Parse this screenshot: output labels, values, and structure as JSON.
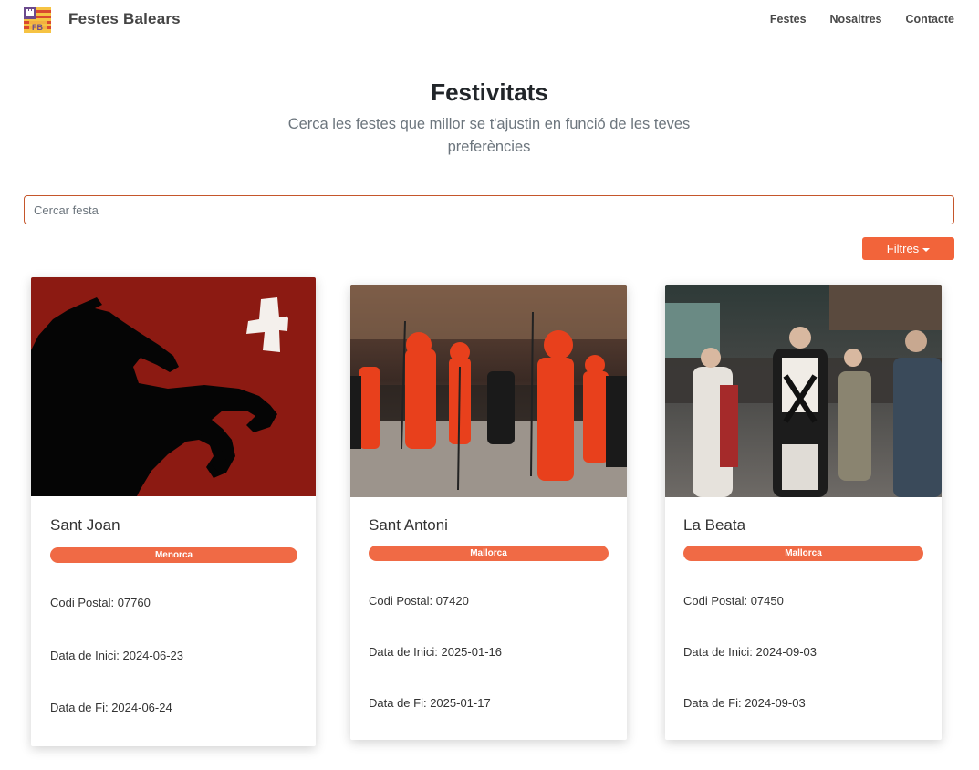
{
  "app": {
    "brand": "Festes Balears",
    "logo_text": "FB",
    "accent_color": "#f2643a"
  },
  "nav": {
    "items": [
      {
        "label": "Festes"
      },
      {
        "label": "Nosaltres"
      },
      {
        "label": "Contacte"
      }
    ]
  },
  "header": {
    "title": "Festivitats",
    "subtitle": "Cerca les festes que millor se t'ajustin en funció de les teves preferències"
  },
  "search": {
    "placeholder": "Cercar festa",
    "value": ""
  },
  "filters": {
    "label": "Filtres"
  },
  "cards": [
    {
      "title": "Sant Joan",
      "island": "Menorca",
      "postal": "Codi Postal: 07760",
      "start": "Data de Inici: 2024-06-23",
      "end": "Data de Fi: 2024-06-24",
      "image": "black-horse-and-white-cross-on-red"
    },
    {
      "title": "Sant Antoni",
      "island": "Mallorca",
      "postal": "Codi Postal: 07420",
      "start": "Data de Inici: 2025-01-16",
      "end": "Data de Fi: 2025-01-17",
      "image": "people-in-red-devil-costumes-in-street"
    },
    {
      "title": "La Beata",
      "island": "Mallorca",
      "postal": "Codi Postal: 07450",
      "start": "Data de Inici: 2024-09-03",
      "end": "Data de Fi: 2024-09-03",
      "image": "night-procession-with-nun-costumes"
    }
  ]
}
